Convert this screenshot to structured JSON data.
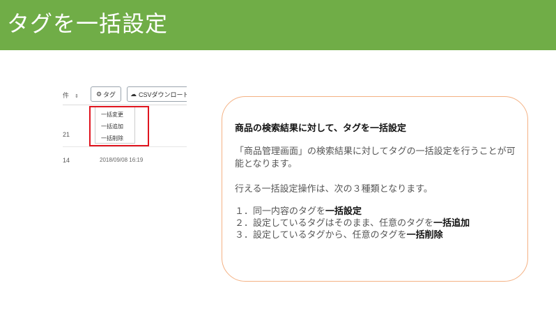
{
  "slide": {
    "title": "タグを一括設定"
  },
  "snippet": {
    "count_select": "件",
    "tag_button": "タグ",
    "csv_button": "CSVダウンロード",
    "dropdown": [
      "一括変更",
      "一括追加",
      "一括削除"
    ],
    "rows": [
      {
        "time": "21",
        "date": ""
      },
      {
        "time": "14",
        "date": "2018/09/08 16:19"
      }
    ]
  },
  "callout": {
    "heading": "商品の検索結果に対して、タグを一括設定",
    "para1": "「商品管理画面」の検索結果に対してタグの一括設定を行うことが可能となります。",
    "para2": "行える一括設定操作は、次の３種類となります。",
    "items": [
      {
        "prefix": "１．同一内容のタグを",
        "bold": "一括設定"
      },
      {
        "prefix": "２．設定しているタグはそのまま、任意のタグを",
        "bold": "一括追加"
      },
      {
        "prefix": "３．設定しているタグから、任意のタグを",
        "bold": "一括削除"
      }
    ]
  },
  "colors": {
    "title_bar": "#70ad47",
    "highlight": "#e0141e",
    "callout_border": "#f4b183"
  }
}
